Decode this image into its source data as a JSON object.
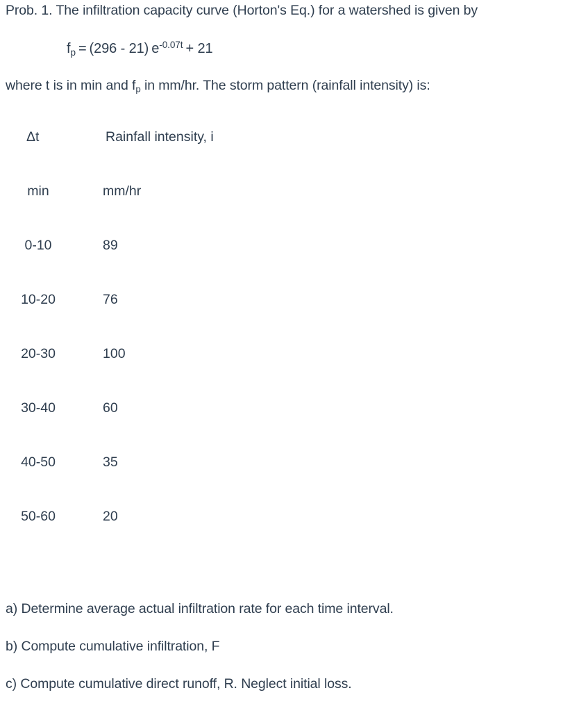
{
  "problem": {
    "statement_line_1": "Prob. 1.  The infiltration capacity curve (Horton's Eq.) for a watershed is given by",
    "formula": {
      "lhs_base": "f",
      "lhs_sub": "p",
      "equals": "=",
      "factor": "(296 - 21)",
      "exp_base": "e",
      "exponent": "-0.07t",
      "plus_term": "+ 21"
    },
    "statement_line_2_part_1": "where t is in min and f",
    "statement_line_2_sub": "p",
    "statement_line_2_part_2": " in mm/hr.  The storm pattern (rainfall intensity) is:"
  },
  "table": {
    "header": {
      "col1": "Δt",
      "col2": "Rainfall intensity, i"
    },
    "units": {
      "col1": "min",
      "col2": "mm/hr"
    },
    "rows": [
      {
        "interval": "0-10",
        "intensity": "89"
      },
      {
        "interval": "10-20",
        "intensity": "76"
      },
      {
        "interval": "20-30",
        "intensity": "100"
      },
      {
        "interval": "30-40",
        "intensity": "60"
      },
      {
        "interval": "40-50",
        "intensity": "35"
      },
      {
        "interval": "50-60",
        "intensity": "20"
      }
    ]
  },
  "questions": [
    "a) Determine average actual infiltration rate for each time interval.",
    "b) Compute cumulative infiltration, F",
    "c) Compute cumulative direct runoff, R. Neglect initial loss."
  ],
  "colors": {
    "text": "#2f3e4f",
    "background": "#ffffff"
  }
}
